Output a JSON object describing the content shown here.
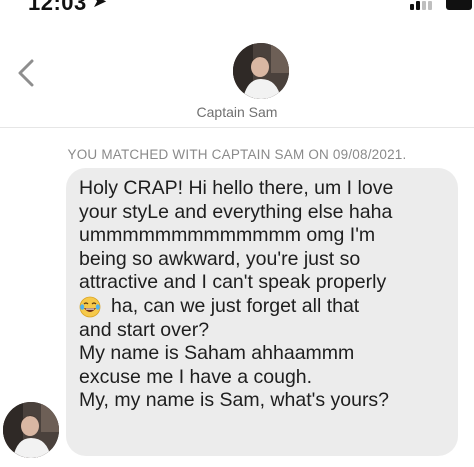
{
  "status_bar": {
    "time": "12:03",
    "location_icon": "location-arrow-icon"
  },
  "header": {
    "back_icon": "chevron-left-icon",
    "contact_name": "Captain Sam"
  },
  "match_notice": "YOU MATCHED WITH CAPTAIN SAM ON 09/08/2021.",
  "message": {
    "emoji": "laughing-crying-emoji",
    "lines": [
      "Holy CRAP! Hi hello there, um I love",
      "your styLe and everything else haha",
      "ummmmmmmmmmmmm omg I'm",
      "being so awkward, you're just so",
      "attractive and I can't speak properly",
      "ha, can we just forget all that",
      "and start over?",
      "My name is Saham ahhaammm",
      "excuse me I have a cough.",
      "My, my name is Sam, what's yours?"
    ]
  },
  "colors": {
    "bubble": "#ececec",
    "notice_text": "#8a8a8a",
    "name_text": "#707070"
  }
}
